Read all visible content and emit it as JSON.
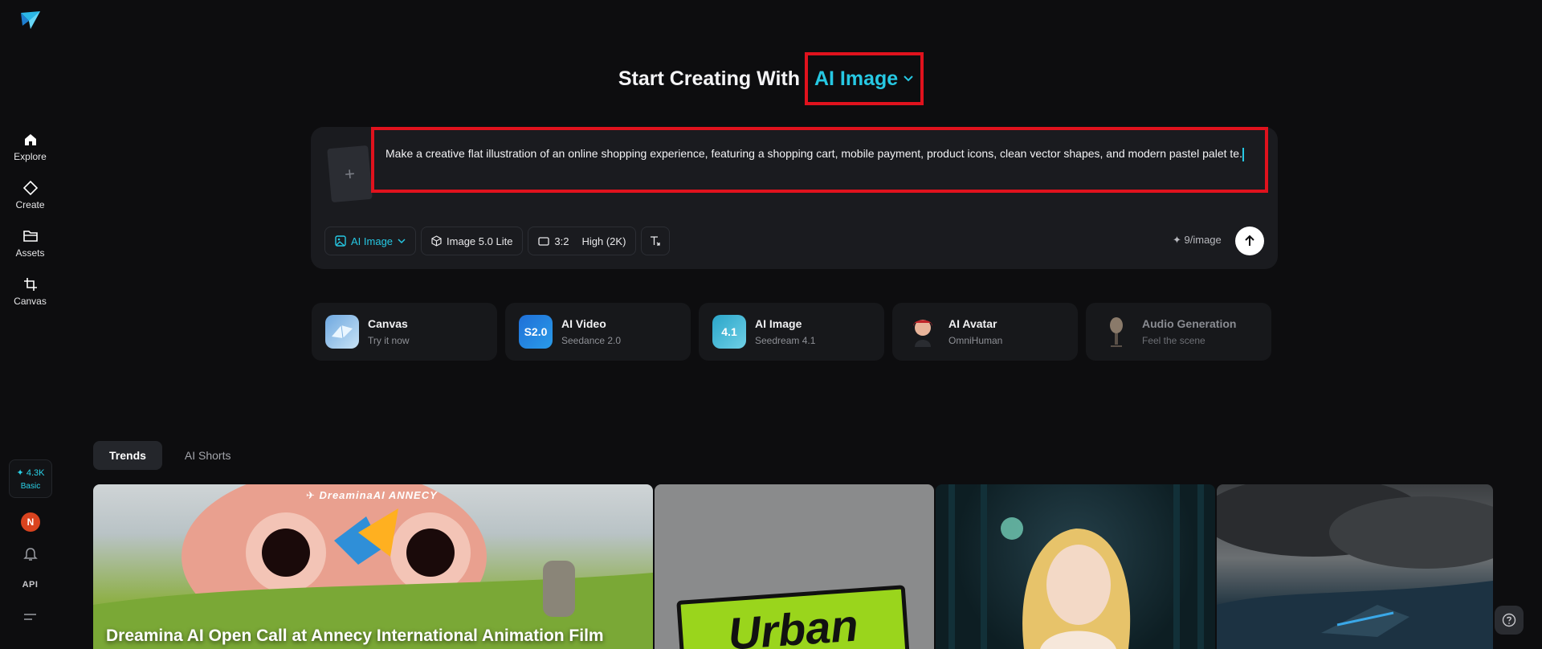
{
  "nav": {
    "items": [
      {
        "label": "Explore",
        "icon": "home-icon"
      },
      {
        "label": "Create",
        "icon": "diamond-icon"
      },
      {
        "label": "Assets",
        "icon": "folder-icon"
      },
      {
        "label": "Canvas",
        "icon": "crop-icon"
      }
    ],
    "credits": "✦ 4.3K",
    "plan": "Basic",
    "avatar_initial": "N",
    "api_label": "API"
  },
  "hero": {
    "title": "Start Creating With",
    "mode": "AI Image"
  },
  "prompt": {
    "text": "Make a creative flat illustration of an online shopping experience, featuring a shopping cart, mobile payment, product icons, clean vector shapes, and modern pastel palet te.",
    "upload_plus": "+"
  },
  "toolbar": {
    "mode_label": "AI Image",
    "model_label": "Image 5.0 Lite",
    "ratio_label": "3:2",
    "quality_label": "High (2K)",
    "cost": "✦ 9/image"
  },
  "features": [
    {
      "title": "Canvas",
      "subtitle": "Try it now",
      "thumb": ""
    },
    {
      "title": "AI Video",
      "subtitle": "Seedance 2.0",
      "thumb": "S2.0"
    },
    {
      "title": "AI Image",
      "subtitle": "Seedream 4.1",
      "thumb": "4.1"
    },
    {
      "title": "AI Avatar",
      "subtitle": "OmniHuman",
      "thumb": ""
    },
    {
      "title": "Audio Generation",
      "subtitle": "Feel the scene",
      "thumb": ""
    }
  ],
  "tabs": [
    {
      "label": "Trends"
    },
    {
      "label": "AI Shorts"
    }
  ],
  "gallery": {
    "banner_title": "Dreamina AI Open Call at Annecy International Animation Film",
    "banner_logos": "✈ DreaminaAI   ANNECY",
    "tile2_text": "Urban"
  },
  "colors": {
    "accent": "#26c8e3",
    "highlight": "#e0121d",
    "background": "#0d0d0f"
  }
}
